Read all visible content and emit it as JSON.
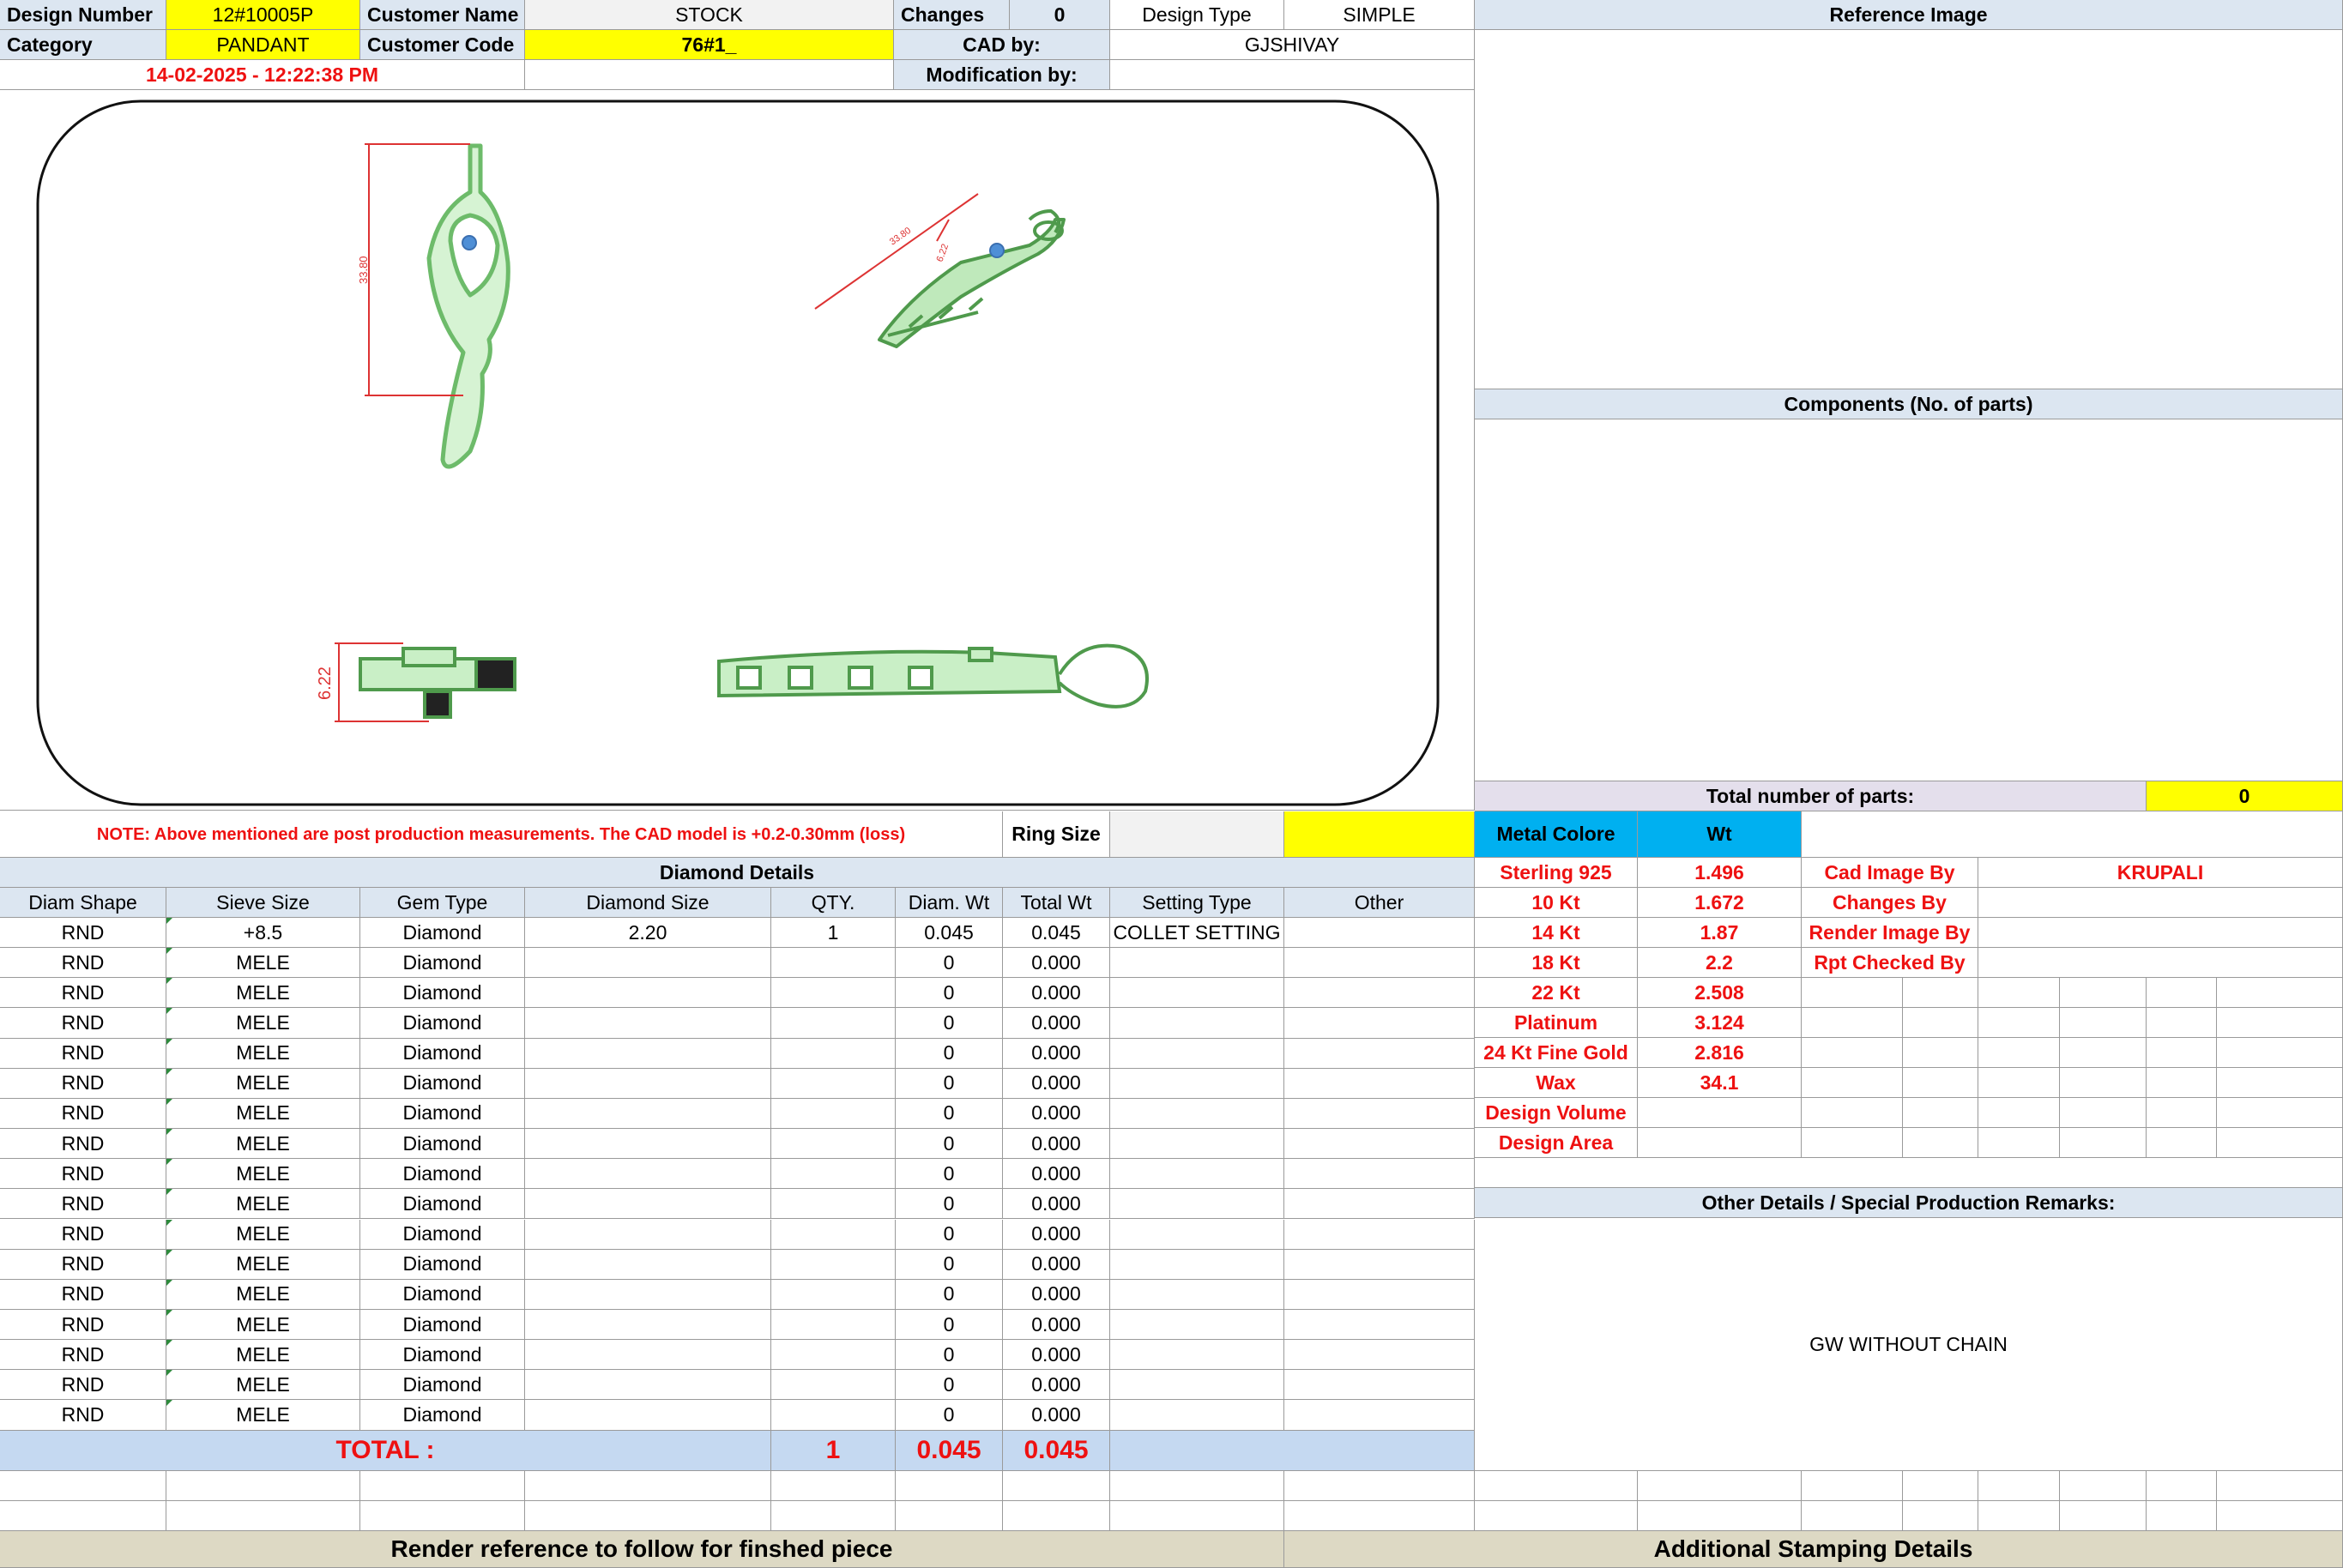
{
  "header": {
    "design_number_label": "Design Number",
    "design_number": "12#10005P",
    "customer_name_label": "Customer Name",
    "customer_name": "STOCK",
    "changes_label": "Changes",
    "changes": "0",
    "design_type_label": "Design Type",
    "design_type": "SIMPLE",
    "reference_image_label": "Reference Image",
    "category_label": "Category",
    "category": "PANDANT",
    "customer_code_label": "Customer Code",
    "customer_code": "76#1_",
    "cad_by_label": "CAD by:",
    "cad_by": "GJSHIVAY",
    "timestamp": "14-02-2025 - 12:22:38 PM",
    "modification_by_label": "Modification by:",
    "modification_by": ""
  },
  "cad": {
    "dim_front": "33.80",
    "dim_angle_length": "33.80",
    "dim_angle_width": "6.22",
    "dim_side": "6.22"
  },
  "components": {
    "title": "Components (No. of parts)",
    "total_label": "Total number of parts:",
    "total_value": "0"
  },
  "note": "NOTE: Above mentioned are post production measurements. The CAD model is +0.2-0.30mm (loss)",
  "ring_size_label": "Ring Size",
  "ring_size": "",
  "metal": {
    "colore_label": "Metal Colore",
    "wt_label": "Wt",
    "rows": [
      {
        "name": "Sterling 925",
        "wt": "1.496"
      },
      {
        "name": "10 Kt",
        "wt": "1.672"
      },
      {
        "name": "14 Kt",
        "wt": "1.87"
      },
      {
        "name": "18 Kt",
        "wt": "2.2"
      },
      {
        "name": "22 Kt",
        "wt": "2.508"
      },
      {
        "name": "Platinum",
        "wt": "3.124"
      },
      {
        "name": "24 Kt Fine Gold",
        "wt": "2.816"
      },
      {
        "name": "Wax",
        "wt": "34.1"
      },
      {
        "name": "Design Volume",
        "wt": ""
      },
      {
        "name": "Design Area",
        "wt": ""
      }
    ]
  },
  "credits": {
    "cad_image_by_label": "Cad Image By",
    "cad_image_by": "KRUPALI",
    "changes_by_label": "Changes By",
    "render_image_by_label": "Render Image By",
    "rpt_checked_by_label": "Rpt Checked By"
  },
  "other_details": {
    "title": "Other Details / Special Production Remarks:",
    "remark": "GW WITHOUT CHAIN"
  },
  "diamond": {
    "title": "Diamond Details",
    "columns": [
      "Diam Shape",
      "Sieve Size",
      "Gem Type",
      "Diamond Size",
      "QTY.",
      "Diam. Wt",
      "Total Wt",
      "Setting Type",
      "Other"
    ],
    "rows": [
      [
        "RND",
        "+8.5",
        "Diamond",
        "2.20",
        "1",
        "0.045",
        "0.045",
        "COLLET SETTING",
        ""
      ],
      [
        "RND",
        "MELE",
        "Diamond",
        "",
        "",
        "0",
        "0.000",
        "",
        ""
      ],
      [
        "RND",
        "MELE",
        "Diamond",
        "",
        "",
        "0",
        "0.000",
        "",
        ""
      ],
      [
        "RND",
        "MELE",
        "Diamond",
        "",
        "",
        "0",
        "0.000",
        "",
        ""
      ],
      [
        "RND",
        "MELE",
        "Diamond",
        "",
        "",
        "0",
        "0.000",
        "",
        ""
      ],
      [
        "RND",
        "MELE",
        "Diamond",
        "",
        "",
        "0",
        "0.000",
        "",
        ""
      ],
      [
        "RND",
        "MELE",
        "Diamond",
        "",
        "",
        "0",
        "0.000",
        "",
        ""
      ],
      [
        "RND",
        "MELE",
        "Diamond",
        "",
        "",
        "0",
        "0.000",
        "",
        ""
      ],
      [
        "RND",
        "MELE",
        "Diamond",
        "",
        "",
        "0",
        "0.000",
        "",
        ""
      ],
      [
        "RND",
        "MELE",
        "Diamond",
        "",
        "",
        "0",
        "0.000",
        "",
        ""
      ],
      [
        "RND",
        "MELE",
        "Diamond",
        "",
        "",
        "0",
        "0.000",
        "",
        ""
      ],
      [
        "RND",
        "MELE",
        "Diamond",
        "",
        "",
        "0",
        "0.000",
        "",
        ""
      ],
      [
        "RND",
        "MELE",
        "Diamond",
        "",
        "",
        "0",
        "0.000",
        "",
        ""
      ],
      [
        "RND",
        "MELE",
        "Diamond",
        "",
        "",
        "0",
        "0.000",
        "",
        ""
      ],
      [
        "RND",
        "MELE",
        "Diamond",
        "",
        "",
        "0",
        "0.000",
        "",
        ""
      ],
      [
        "RND",
        "MELE",
        "Diamond",
        "",
        "",
        "0",
        "0.000",
        "",
        ""
      ],
      [
        "RND",
        "MELE",
        "Diamond",
        "",
        "",
        "0",
        "0.000",
        "",
        ""
      ]
    ],
    "total_label": "TOTAL :",
    "total_qty": "1",
    "total_diam_wt": "0.045",
    "total_wt": "0.045"
  },
  "footer": {
    "render_reference": "Render reference to follow for finshed piece",
    "stamping": "Additional Stamping Details"
  },
  "colors": {
    "header_blue": "#dce6f1",
    "highlight_yellow": "#ffff00",
    "metal_blue": "#00b0f0",
    "label_red": "#ee1111",
    "footer_tan": "#ddd9c4",
    "cad_green": "#b9ecb6"
  }
}
